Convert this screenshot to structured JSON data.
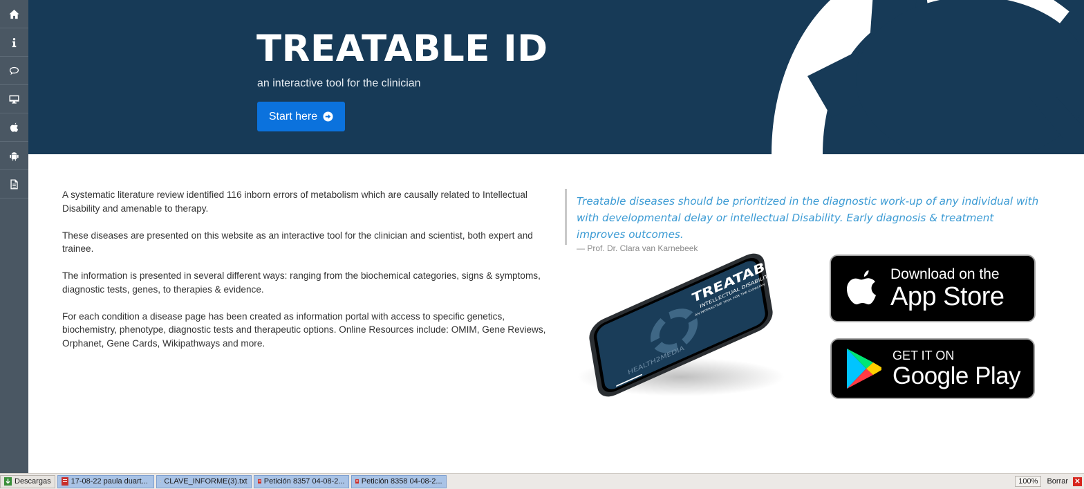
{
  "sidebar": {
    "items": [
      {
        "icon": "home-icon"
      },
      {
        "icon": "info-icon"
      },
      {
        "icon": "chat-bubble-icon"
      },
      {
        "icon": "desktop-icon"
      },
      {
        "icon": "apple-icon"
      },
      {
        "icon": "android-icon"
      },
      {
        "icon": "document-icon"
      }
    ]
  },
  "hero": {
    "title": "TREATABLE ID",
    "subtitle": "an interactive tool for the clinician",
    "cta_label": "Start here"
  },
  "intro": {
    "paragraphs": [
      "A systematic literature review identified 116 inborn errors of metabolism which are causally related to Intellectual Disability and amenable to therapy.",
      "These diseases are presented on this website as an interactive tool for the clinician and scientist, both expert and trainee.",
      "The information is presented in several different ways: ranging from the biochemical categories, signs & symptoms, diagnostic tests, genes, to therapies & evidence.",
      "For each condition a disease page has been created as information portal with access to specific genetics, biochemistry, phenotype, diagnostic tests and therapeutic options. Online Resources include: OMIM, Gene Reviews, Orphanet, Gene Cards, Wikipathways and more."
    ]
  },
  "quote": {
    "text": "Treatable diseases should be prioritized in the diagnostic work-up of any individual with with developmental delay or intellectual Disability. Early diagnosis & treatment improves outcomes.",
    "author": "— Prof. Dr. Clara van Karnebeek"
  },
  "phone_screen": {
    "title": "TREATABLE",
    "line2": "INTELLECTUAL DISABILITY",
    "line3": "AN INTERACTIVE TOOL FOR THE CLINICIAN",
    "brand": "HEALTH2MEDIA"
  },
  "app_store": {
    "line1": "Download on the",
    "line2": "App Store"
  },
  "google_play": {
    "line1": "GET IT ON",
    "line2": "Google Play"
  },
  "download_bar": {
    "first_label": "Descargas",
    "files": [
      {
        "name": "17-08-22 paula duart...",
        "type": "pdf"
      },
      {
        "name": "CLAVE_INFORME(3).txt",
        "type": "txt"
      },
      {
        "name": "Petición 8357 04-08-2...",
        "type": "pdf"
      },
      {
        "name": "Petición 8358 04-08-2...",
        "type": "pdf"
      }
    ],
    "zoom": "100%",
    "clear_label": "Borrar"
  },
  "colors": {
    "hero_bg": "#173a57",
    "accent_blue": "#0b72dd",
    "quote_blue": "#3c9bd4",
    "sidebar_bg": "#4a5763"
  }
}
